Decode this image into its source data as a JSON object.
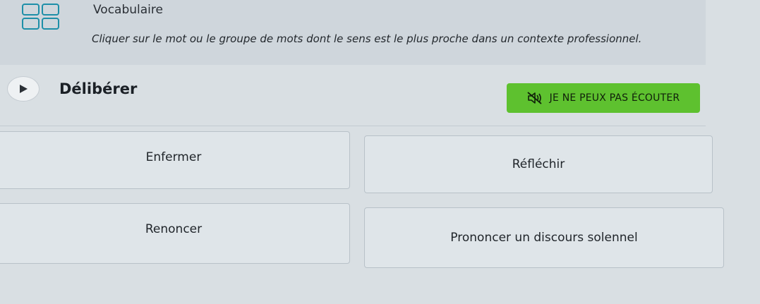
{
  "header": {
    "title": "Vocabulaire",
    "instruction": "Cliquer sur le mot ou le groupe de mots dont le sens est le plus proche dans un contexte professionnel."
  },
  "question": {
    "word": "Délibérer",
    "cant_listen_label": "JE NE PEUX PAS ÉCOUTER"
  },
  "answers": [
    {
      "label": "Enfermer"
    },
    {
      "label": "Réfléchir"
    },
    {
      "label": "Renoncer"
    },
    {
      "label": "Prononcer un discours solennel"
    }
  ],
  "colors": {
    "accent_green": "#5ec12f",
    "background": "#d9dfe3"
  }
}
